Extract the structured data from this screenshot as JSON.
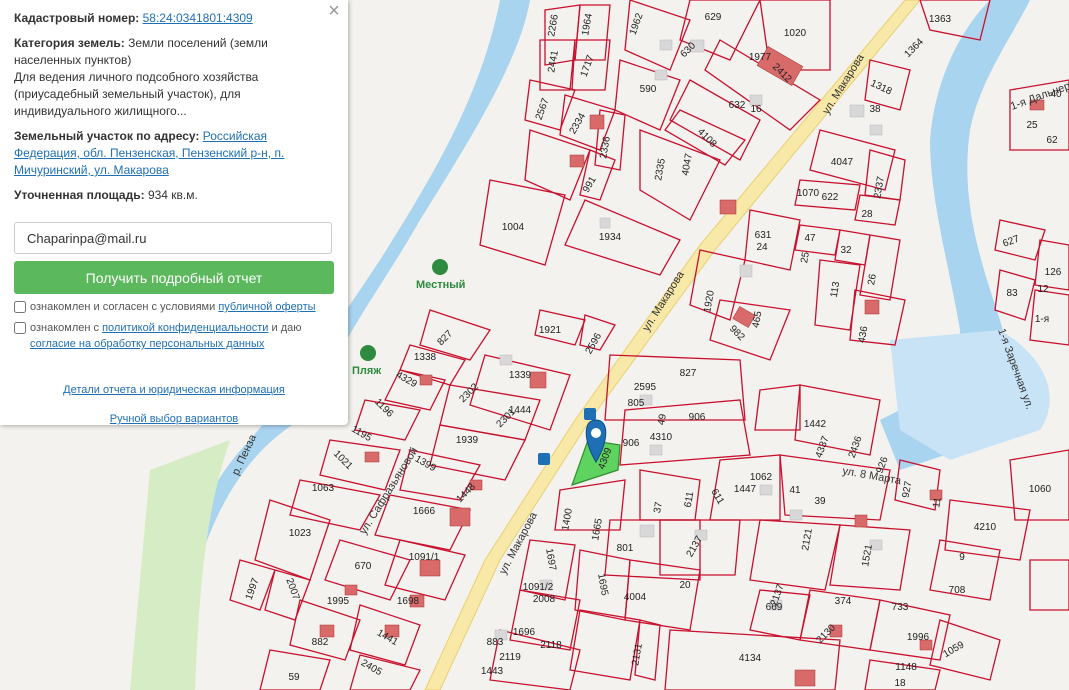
{
  "panel": {
    "cadastral_label": "Кадастровый номер:",
    "cadastral_value": "58:24:0341801:4309",
    "category_label": "Категория земель:",
    "category_value": "Земли поселений (земли населенных пунктов)",
    "usage_text": "Для ведения личного подсобного хозяйства (приусадебный земельный участок), для индивидуального жилищного...",
    "address_label": "Земельный участок по адресу:",
    "address_value": "Российская Федерация, обл. Пензенская, Пензенский р-н, п. Мичуринский, ул. Макарова",
    "area_label": "Уточненная площадь:",
    "area_value": "934 кв.м.",
    "email_value": "Chaparinpa@mail.ru",
    "report_button": "Получить подробный отчет",
    "consent1_text": "ознакомлен и согласен с условиями",
    "consent1_link": "публичной оферты",
    "consent2_text": "ознакомлен с",
    "consent2_link": "политикой конфиденциальности",
    "consent2_mid": "и даю",
    "consent2_link2": "согласие на обработку персональных данных",
    "details_link": "Детали отчета и юридическая информация",
    "manual_link": "Ручной выбор вариантов",
    "close_glyph": "×"
  },
  "map": {
    "streets": [
      "ул. Макарова",
      "ул. Макарова",
      "ул. Макарова",
      "ул. 8 Марта",
      "1-я Заречная ул.",
      "ул. Сафразьяновой",
      "1-я Дальнеречен",
      "р. Пенза"
    ],
    "pois": [
      "Местный",
      "Пляж"
    ],
    "selected_plot": "4309",
    "plot_numbers": [
      "2266",
      "1964",
      "1962",
      "629",
      "1020",
      "1363",
      "2441",
      "1717",
      "630",
      "1977",
      "2412",
      "1364",
      "590",
      "1318",
      "2567",
      "2334",
      "632",
      "16",
      "38",
      "2336",
      "4108",
      "2335",
      "4047",
      "4047",
      "991",
      "2337",
      "1070",
      "622",
      "28",
      "1004",
      "1934",
      "631",
      "24",
      "47",
      "25",
      "32",
      "26",
      "1920",
      "113",
      "982",
      "465",
      "436",
      "1921",
      "2596",
      "2595",
      "827",
      "827",
      "1338",
      "1339",
      "805",
      "49",
      "906",
      "906",
      "4310",
      "4329",
      "2302",
      "1442",
      "4337",
      "2436",
      "926",
      "927",
      "1196",
      "2301",
      "1444",
      "11",
      "1195",
      "1939",
      "1021",
      "1399",
      "1448",
      "1447",
      "1062",
      "41",
      "39",
      "37",
      "611",
      "611",
      "1063",
      "1400",
      "1665",
      "1666",
      "1023",
      "801",
      "2137",
      "2121",
      "670",
      "1697",
      "1091/1",
      "1521",
      "1995",
      "1698",
      "1695",
      "4004",
      "1091/2",
      "20",
      "2137",
      "669",
      "374",
      "1997",
      "2007",
      "2008",
      "9",
      "708",
      "733",
      "882",
      "1441",
      "1696",
      "2118",
      "2130",
      "1996",
      "1059",
      "883",
      "2119",
      "2131",
      "4134",
      "1148",
      "59",
      "2405",
      "1443",
      "18",
      "1060",
      "4210",
      "627",
      "126",
      "83",
      "12",
      "40",
      "1-я",
      "62",
      "25",
      "20"
    ]
  },
  "colors": {
    "plot_border": "#c8102e",
    "selected_fill": "#5fd35f",
    "road": "#f8e9a8",
    "river": "#a8d4f0",
    "button": "#5cb85c",
    "link": "#1f6fb5"
  }
}
